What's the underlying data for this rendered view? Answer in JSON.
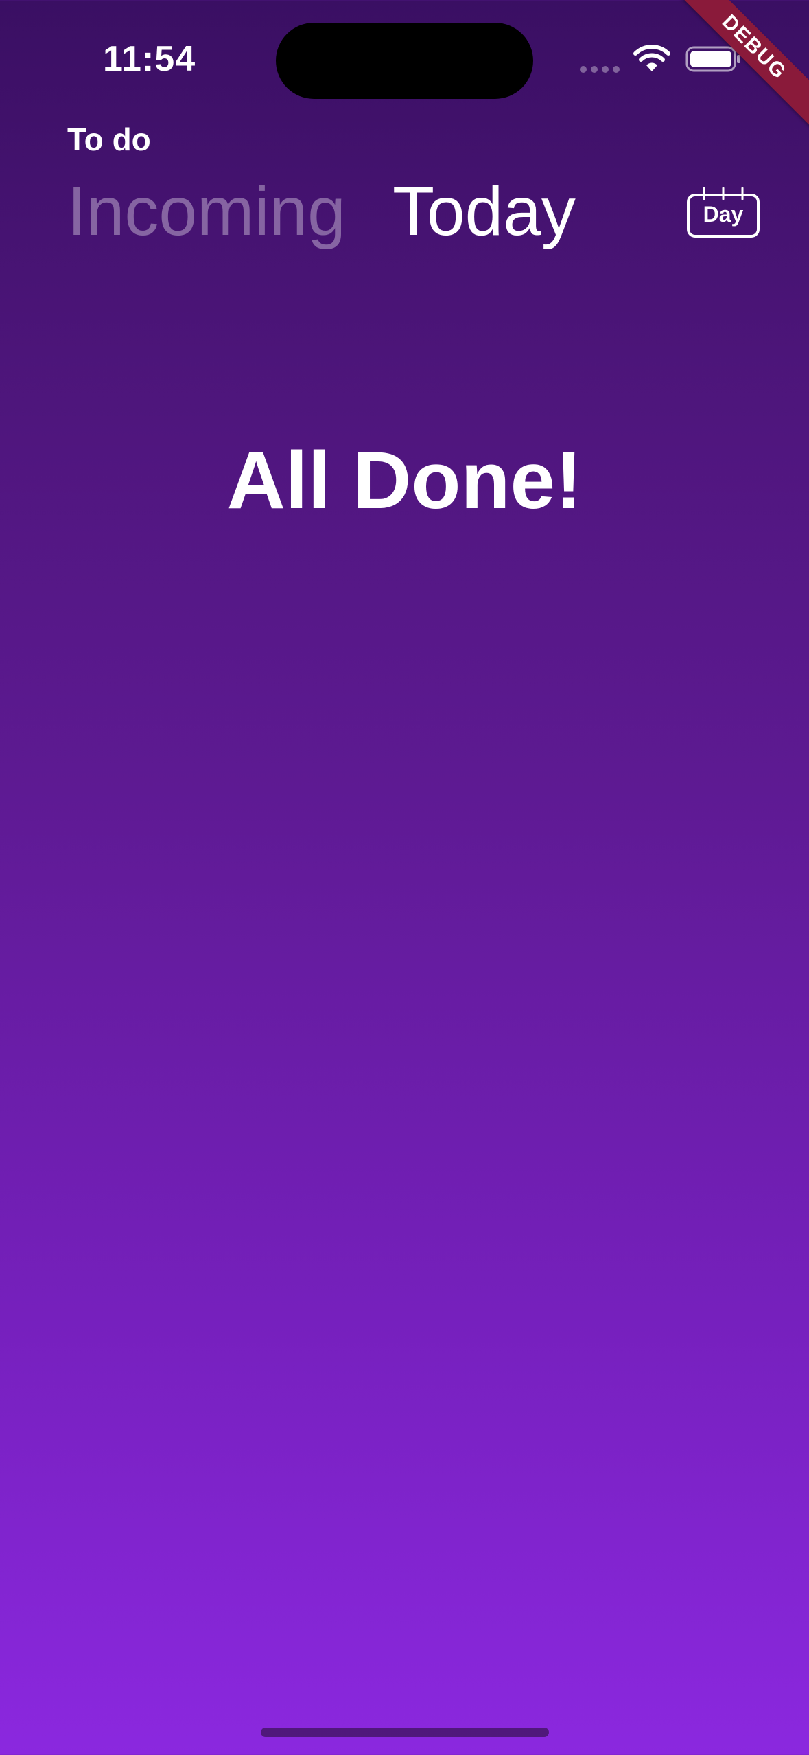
{
  "status_bar": {
    "time": "11:54",
    "icons": [
      "cellular-signal-icon",
      "wifi-icon",
      "battery-icon"
    ]
  },
  "debug_banner": {
    "label": "DEBUG",
    "color": "#8a1a3a"
  },
  "header": {
    "subtitle": "To do",
    "tabs": [
      {
        "label": "Incoming",
        "active": false
      },
      {
        "label": "Today",
        "active": true
      }
    ],
    "day_button": {
      "label": "Day",
      "icon": "calendar-icon"
    }
  },
  "main": {
    "message": "All Done!"
  },
  "colors": {
    "gradient_top": "#3a0f63",
    "gradient_bottom": "#8b28df",
    "text": "#ffffff",
    "inactive_tab": "rgba(255,255,255,0.35)"
  }
}
